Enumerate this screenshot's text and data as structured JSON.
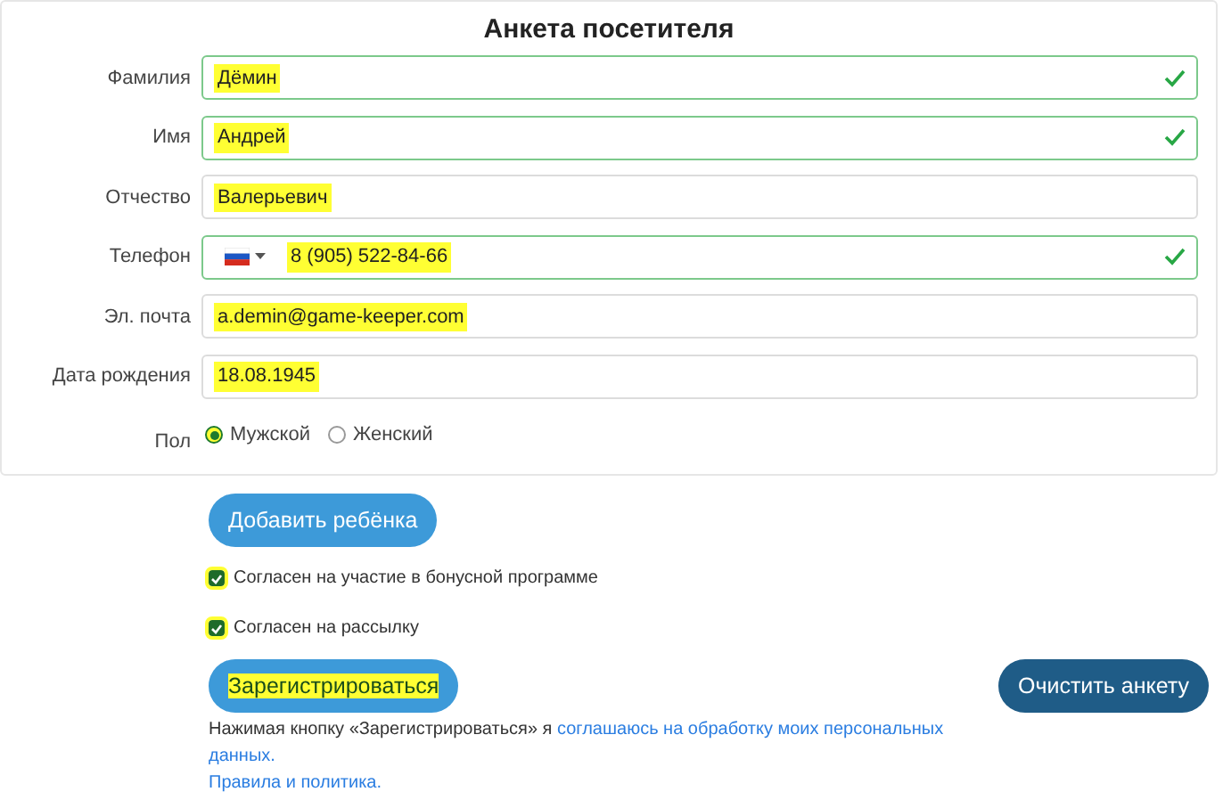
{
  "title": "Анкета посетителя",
  "fields": [
    {
      "kind": "text",
      "label": "Фамилия",
      "value": "Дёмин",
      "valid": true,
      "highlighted": true
    },
    {
      "kind": "text",
      "label": "Имя",
      "value": "Андрей",
      "valid": true,
      "highlighted": true
    },
    {
      "kind": "text",
      "label": "Отчество",
      "value": "Валерьевич",
      "valid": false,
      "highlighted": true
    },
    {
      "kind": "phone",
      "label": "Телефон",
      "value": "8 (905) 522-84-66",
      "valid": true,
      "highlighted": true
    },
    {
      "kind": "text",
      "label": "Эл. почта",
      "value": "a.demin@game-keeper.com",
      "valid": false,
      "highlighted": true
    },
    {
      "kind": "text",
      "label": "Дата рождения",
      "value": "18.08.1945",
      "valid": false,
      "highlighted": true
    }
  ],
  "gender": {
    "label": "Пол",
    "options": [
      {
        "label": "Мужской",
        "selected": true
      },
      {
        "label": "Женский",
        "selected": false
      }
    ]
  },
  "add_child_button": "Добавить ребёнка",
  "checkboxes": [
    {
      "label": "Согласен на участие в бонусной программе",
      "checked": true
    },
    {
      "label": "Согласен на рассылку",
      "checked": true
    }
  ],
  "register_button": {
    "label": "Зарегистрироваться",
    "highlighted": true
  },
  "clear_button": "Очистить анкету",
  "consent": {
    "text": "Нажимая кнопку «Зарегистрироваться» я",
    "link_parts": [
      "соглашаюсь на обработку моих персональных",
      "данных."
    ]
  },
  "policy_link": "Правила и политика."
}
